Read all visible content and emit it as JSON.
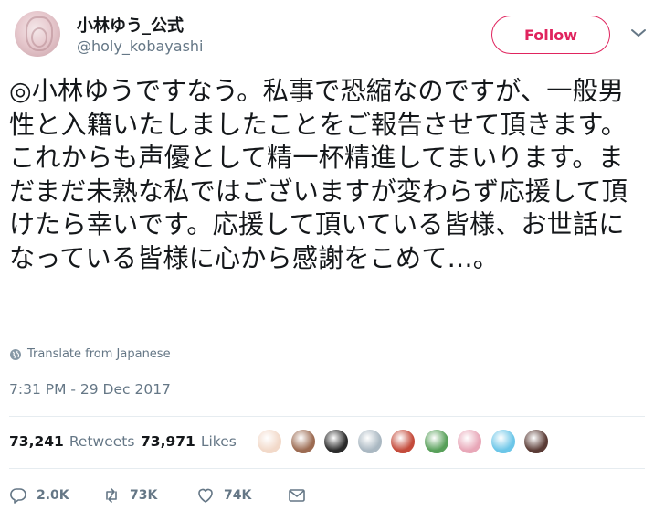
{
  "author": {
    "display_name": "小林ゆう_公式",
    "handle": "@holy_kobayashi"
  },
  "follow_button": {
    "label": "Follow",
    "color": "#e0245e"
  },
  "tweet": {
    "text": "◎小林ゆうですなう。私事で恐縮なのですが、一般男性と入籍いたしましたことをご報告させて頂きます。これからも声優として精一杯精進してまいります。まだまだ未熟な私ではございますが変わらず応援して頂けたら幸いです。応援して頂いている皆様、お世話になっている皆様に心から感謝をこめて…。",
    "translate_label": "Translate from Japanese",
    "timestamp": "7:31 PM - 29 Dec 2017"
  },
  "stats": {
    "retweets_count": "73,241",
    "retweets_label": "Retweets",
    "likes_count": "73,971",
    "likes_label": "Likes"
  },
  "likers": [
    {
      "name": "liker-1",
      "color": "#f2d9c9"
    },
    {
      "name": "liker-2",
      "color": "#9c6b52"
    },
    {
      "name": "liker-3",
      "color": "#2b2b2b"
    },
    {
      "name": "liker-4",
      "color": "#aab8c2"
    },
    {
      "name": "liker-5",
      "color": "#c44b3b"
    },
    {
      "name": "liker-6",
      "color": "#58a05a"
    },
    {
      "name": "liker-7",
      "color": "#e8a7b8"
    },
    {
      "name": "liker-8",
      "color": "#6cc6e8"
    },
    {
      "name": "liker-9",
      "color": "#5a3b35"
    }
  ],
  "actions": {
    "reply_count": "2.0K",
    "retweet_count": "73K",
    "like_count": "74K"
  },
  "icons": [
    "chevron-down-icon",
    "globe-icon",
    "reply-icon",
    "retweet-icon",
    "heart-icon",
    "envelope-icon"
  ],
  "colors": {
    "secondary_text": "#657786",
    "divider": "#e6ecf0"
  }
}
